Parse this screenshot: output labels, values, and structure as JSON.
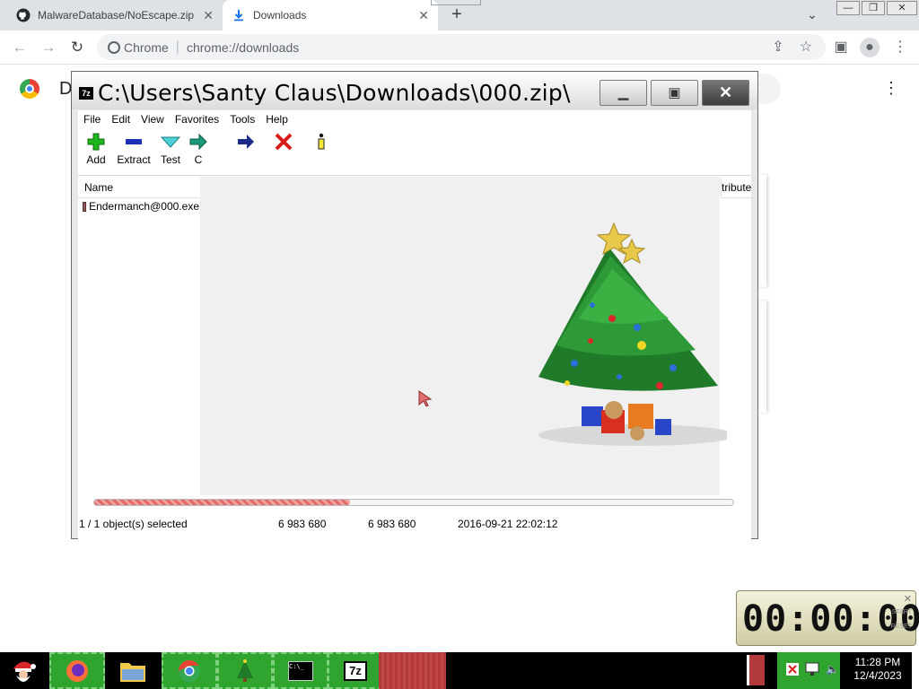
{
  "browser": {
    "tabs": [
      {
        "title": "MalwareDatabase/NoEscape.zip",
        "close": "✕"
      },
      {
        "title": "Downloads",
        "close": "✕"
      }
    ],
    "new_tab": "+",
    "omnibox_site": "Chrome",
    "omnibox_url": "chrome://downloads",
    "page_heading_initial": "D"
  },
  "sevenzip": {
    "title": "C:\\Users\\Santy Claus\\Downloads\\000.zip\\",
    "app_icon": "7z",
    "menu": [
      "File",
      "Edit",
      "View",
      "Favorites",
      "Tools",
      "Help"
    ],
    "toolbar": [
      "Add",
      "Extract",
      "Test",
      "C"
    ],
    "columns": {
      "name": "Name",
      "attributes": "tribute"
    },
    "file": "Endermanch@000.exe",
    "status": {
      "selection": "1 / 1 object(s) selected",
      "size": "6 983 680",
      "packed": "6 983 680",
      "modified": "2016-09-21 22:02:12"
    },
    "progress_fraction": 0.4
  },
  "timer": {
    "display": "00:00:00",
    "close": "✕",
    "start": "START",
    "reset": "RESET"
  },
  "taskbar": {
    "time": "11:28 PM",
    "date": "12/4/2023",
    "cmd_label": "C:\\_",
    "sevenzip_label": "7z"
  }
}
